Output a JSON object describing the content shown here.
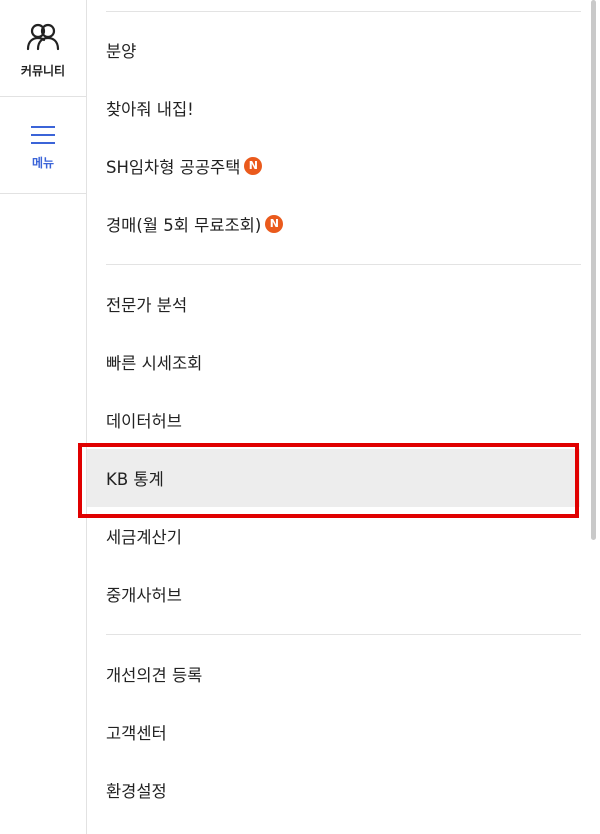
{
  "rail": {
    "community": {
      "label": "커뮤니티",
      "icon": "community-icon"
    },
    "menu": {
      "label": "메뉴",
      "icon": "hamburger-menu-icon"
    }
  },
  "menu": {
    "items": [
      {
        "label": "분양"
      },
      {
        "label": "찾아줘 내집!"
      },
      {
        "label": "SH임차형 공공주택",
        "badge": "N"
      },
      {
        "label": "경매(월 5회 무료조회)",
        "badge": "N"
      },
      {
        "label": "전문가 분석"
      },
      {
        "label": "빠른 시세조회"
      },
      {
        "label": "데이터허브"
      },
      {
        "label": "KB 통계"
      },
      {
        "label": "세금계산기"
      },
      {
        "label": "중개사허브"
      },
      {
        "label": "개선의견 등록"
      },
      {
        "label": "고객센터"
      },
      {
        "label": "환경설정"
      }
    ]
  },
  "colors": {
    "accent": "#3b64d8",
    "badge": "#ea5a1c",
    "highlight_border": "#e00000",
    "active_bg": "#ededed"
  }
}
